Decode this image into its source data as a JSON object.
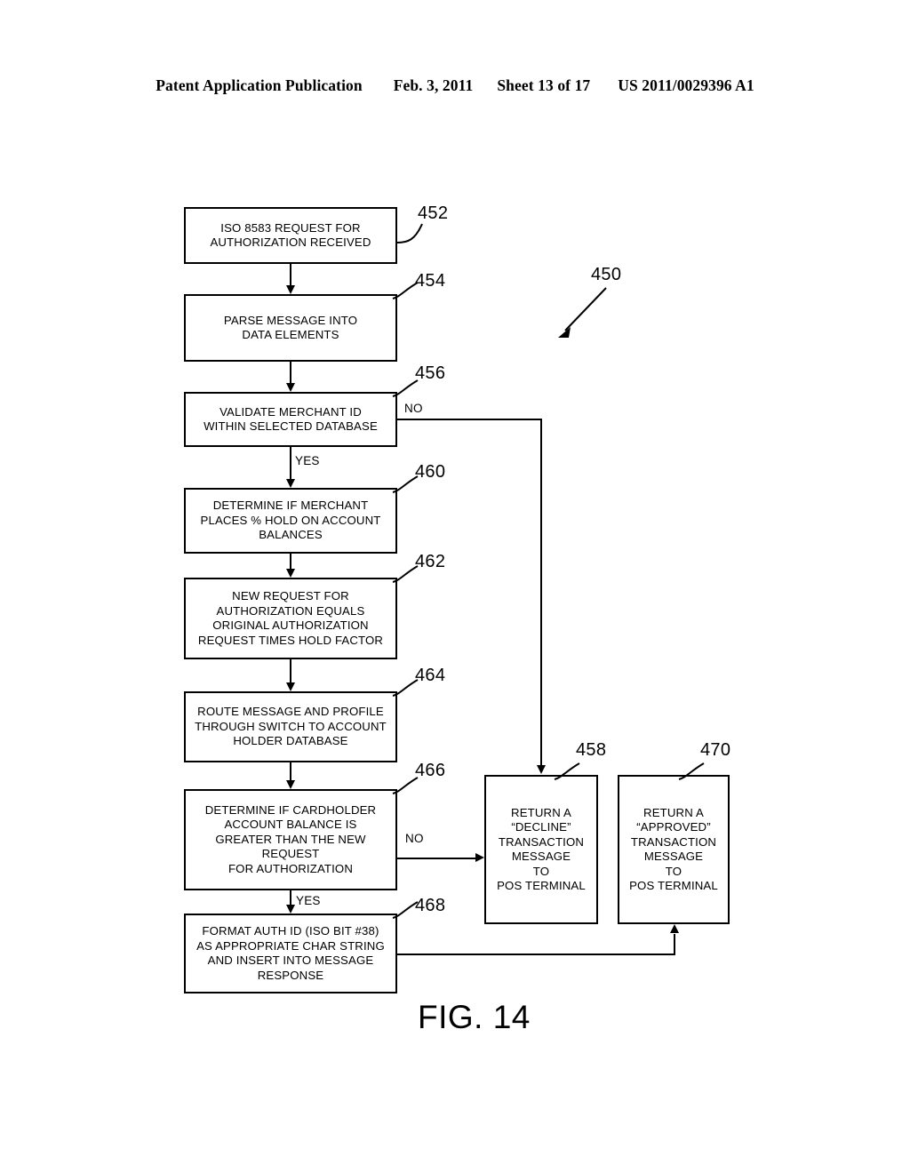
{
  "header": {
    "publication": "Patent Application Publication",
    "date": "Feb. 3, 2011",
    "sheet": "Sheet 13 of 17",
    "number": "US 2011/0029396 A1"
  },
  "figure": {
    "caption": "FIG. 14",
    "diagram_ref": "450"
  },
  "nodes": [
    {
      "ref": "452",
      "text": "ISO 8583 REQUEST FOR\nAUTHORIZATION RECEIVED"
    },
    {
      "ref": "454",
      "text": "PARSE MESSAGE INTO\nDATA ELEMENTS"
    },
    {
      "ref": "456",
      "text": "VALIDATE MERCHANT ID\nWITHIN SELECTED DATABASE"
    },
    {
      "ref": "460",
      "text": "DETERMINE IF MERCHANT\nPLACES % HOLD ON ACCOUNT\nBALANCES"
    },
    {
      "ref": "462",
      "text": "NEW REQUEST FOR\nAUTHORIZATION EQUALS\nORIGINAL AUTHORIZATION\nREQUEST TIMES HOLD FACTOR"
    },
    {
      "ref": "464",
      "text": "ROUTE MESSAGE AND PROFILE\nTHROUGH SWITCH TO ACCOUNT\nHOLDER DATABASE"
    },
    {
      "ref": "466",
      "text": "DETERMINE IF CARDHOLDER\nACCOUNT BALANCE IS\nGREATER THAN THE NEW\nREQUEST\nFOR AUTHORIZATION"
    },
    {
      "ref": "468",
      "text": "FORMAT AUTH ID (ISO BIT #38)\nAS APPROPRIATE CHAR STRING\nAND INSERT INTO MESSAGE\nRESPONSE"
    },
    {
      "ref": "458",
      "text": "RETURN A\n“DECLINE”\nTRANSACTION\nMESSAGE\nTO\nPOS TERMINAL"
    },
    {
      "ref": "470",
      "text": "RETURN A\n“APPROVED”\nTRANSACTION\nMESSAGE\nTO\nPOS TERMINAL"
    }
  ],
  "branch_labels": {
    "validate_no": "NO",
    "validate_yes": "YES",
    "balance_no": "NO",
    "balance_yes": "YES"
  },
  "colors": {
    "ink": "#000000",
    "paper": "#ffffff"
  }
}
